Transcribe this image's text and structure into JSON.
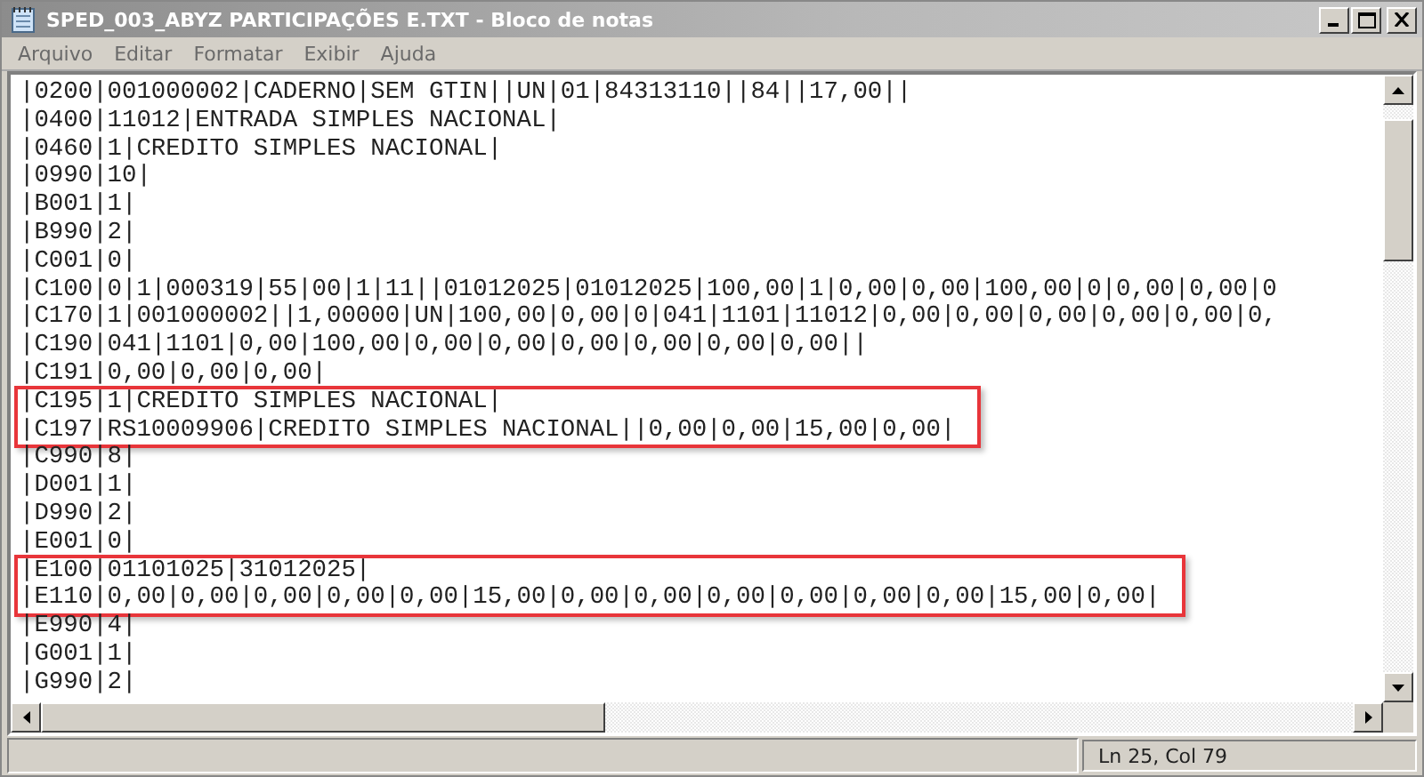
{
  "window": {
    "title": "SPED_003_ABYZ PARTICIPAÇÕES E.TXT - Bloco de notas"
  },
  "menu": [
    "Arquivo",
    "Editar",
    "Formatar",
    "Exibir",
    "Ajuda"
  ],
  "lines": [
    {
      "text": "|0200|001000002|CADERNO|SEM GTIN||UN|01|84313110||84||17,00||",
      "highlighted": false
    },
    {
      "text": "|0400|11012|ENTRADA SIMPLES NACIONAL|",
      "highlighted": false
    },
    {
      "text": "|0460|1|CREDITO SIMPLES NACIONAL|",
      "highlighted": false
    },
    {
      "text": "|0990|10|",
      "highlighted": false
    },
    {
      "text": "|B001|1|",
      "highlighted": false
    },
    {
      "text": "|B990|2|",
      "highlighted": false
    },
    {
      "text": "|C001|0|",
      "highlighted": false
    },
    {
      "text": "|C100|0|1|000319|55|00|1|11||01012025|01012025|100,00|1|0,00|0,00|100,00|0|0,00|0,00|0",
      "highlighted": false
    },
    {
      "text": "|C170|1|001000002||1,00000|UN|100,00|0,00|0|041|1101|11012|0,00|0,00|0,00|0,00|0,00|0,",
      "highlighted": false
    },
    {
      "text": "|C190|041|1101|0,00|100,00|0,00|0,00|0,00|0,00|0,00|0,00||",
      "highlighted": false
    },
    {
      "text": "|C191|0,00|0,00|0,00|",
      "highlighted": false
    },
    {
      "text": "|C195|1|CREDITO SIMPLES NACIONAL|",
      "highlighted": true
    },
    {
      "text": "|C197|RS10009906|CREDITO SIMPLES NACIONAL||0,00|0,00|15,00|0,00|",
      "highlighted": true
    },
    {
      "text": "|C990|8|",
      "highlighted": false
    },
    {
      "text": "|D001|1|",
      "highlighted": false
    },
    {
      "text": "|D990|2|",
      "highlighted": false
    },
    {
      "text": "|E001|0|",
      "highlighted": false
    },
    {
      "text": "|E100|01101025|31012025|",
      "highlighted": true
    },
    {
      "text": "|E110|0,00|0,00|0,00|0,00|0,00|15,00|0,00|0,00|0,00|0,00|0,00|0,00|15,00|0,00|",
      "highlighted": true
    },
    {
      "text": "|E990|4|",
      "highlighted": false
    },
    {
      "text": "|G001|1|",
      "highlighted": false
    },
    {
      "text": "|G990|2|",
      "highlighted": false
    }
  ],
  "status_bar": {
    "position": "Ln 25, Col 79"
  }
}
